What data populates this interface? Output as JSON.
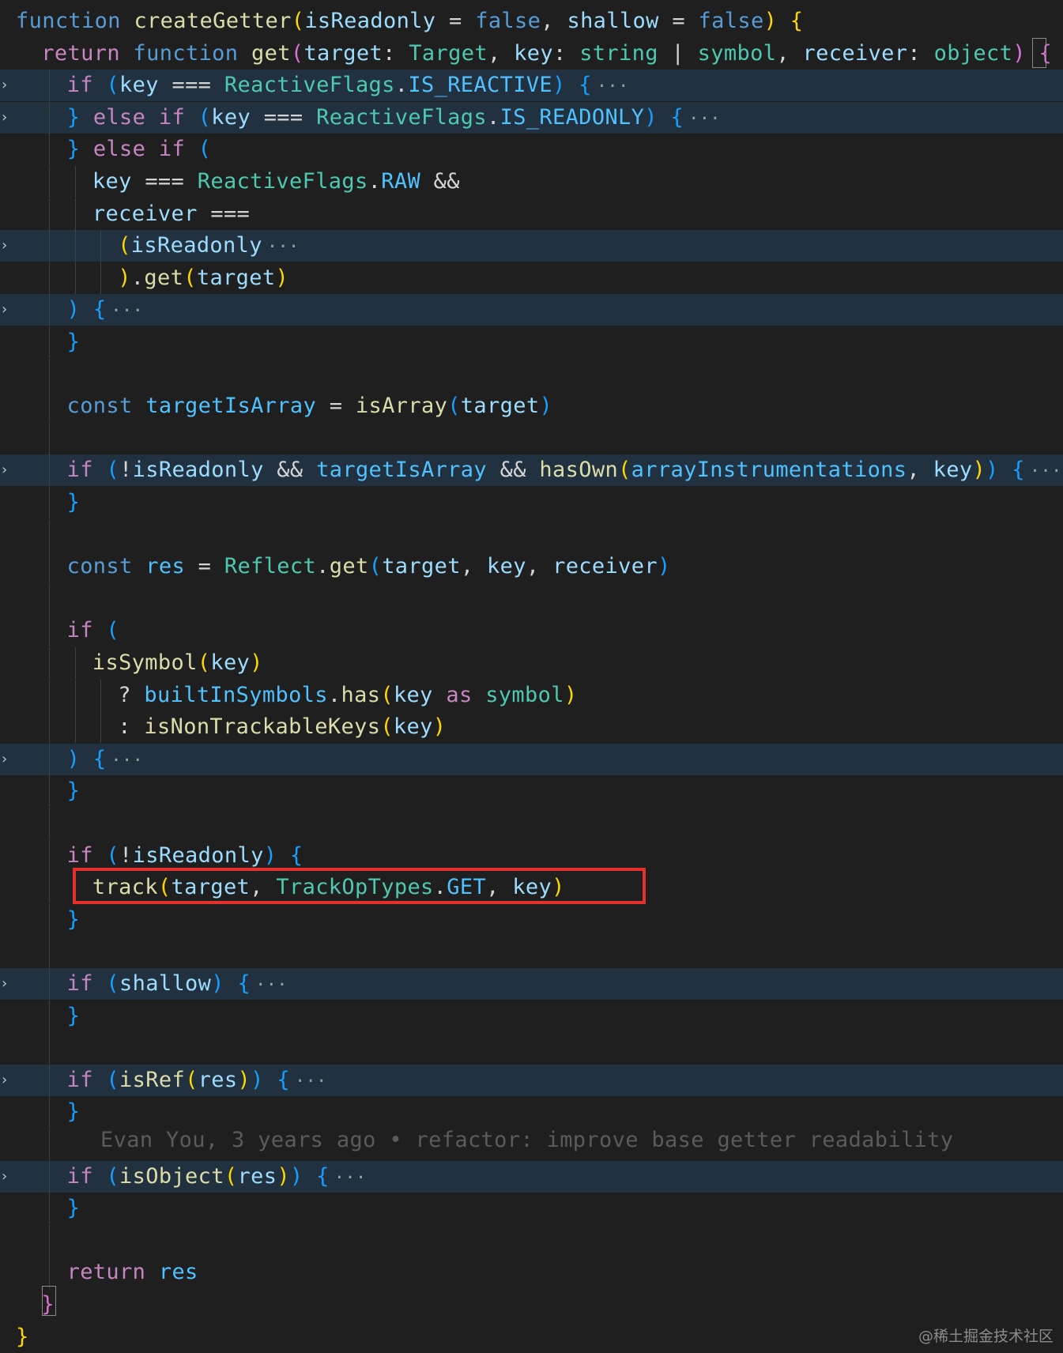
{
  "editor": {
    "lines": [
      {
        "fold": false,
        "hl": false,
        "indent": 0,
        "tokens": [
          [
            "kw",
            "function "
          ],
          [
            "fn",
            "createGetter"
          ],
          [
            "b1",
            "("
          ],
          [
            "var",
            "isReadonly"
          ],
          [
            "op",
            " = "
          ],
          [
            "kw",
            "false"
          ],
          [
            "op",
            ", "
          ],
          [
            "var",
            "shallow"
          ],
          [
            "op",
            " = "
          ],
          [
            "kw",
            "false"
          ],
          [
            "b1",
            ")"
          ],
          [
            "op",
            " "
          ],
          [
            "b1",
            "{"
          ]
        ]
      },
      {
        "fold": false,
        "hl": false,
        "indent": 1,
        "tokens": [
          [
            "ctl",
            "return "
          ],
          [
            "kw",
            "function "
          ],
          [
            "fn",
            "get"
          ],
          [
            "b2",
            "("
          ],
          [
            "var",
            "target"
          ],
          [
            "op",
            ": "
          ],
          [
            "typ",
            "Target"
          ],
          [
            "op",
            ", "
          ],
          [
            "var",
            "key"
          ],
          [
            "op",
            ": "
          ],
          [
            "typ",
            "string"
          ],
          [
            "op",
            " | "
          ],
          [
            "typ",
            "symbol"
          ],
          [
            "op",
            ", "
          ],
          [
            "var",
            "receiver"
          ],
          [
            "op",
            ": "
          ],
          [
            "typ",
            "object"
          ],
          [
            "b2",
            ")"
          ],
          [
            "op",
            " "
          ],
          [
            "b2",
            "{"
          ]
        ]
      },
      {
        "fold": true,
        "hl": true,
        "indent": 2,
        "tokens": [
          [
            "ctl",
            "if "
          ],
          [
            "b3",
            "("
          ],
          [
            "var",
            "key"
          ],
          [
            "op",
            " === "
          ],
          [
            "typ",
            "ReactiveFlags"
          ],
          [
            "op",
            "."
          ],
          [
            "cst",
            "IS_REACTIVE"
          ],
          [
            "b3",
            ")"
          ],
          [
            "op",
            " "
          ],
          [
            "b3",
            "{"
          ]
        ],
        "ellipsis": "···"
      },
      {
        "fold": true,
        "hl": true,
        "indent": 2,
        "tokens": [
          [
            "b3",
            "}"
          ],
          [
            "op",
            " "
          ],
          [
            "ctl",
            "else if "
          ],
          [
            "b3",
            "("
          ],
          [
            "var",
            "key"
          ],
          [
            "op",
            " === "
          ],
          [
            "typ",
            "ReactiveFlags"
          ],
          [
            "op",
            "."
          ],
          [
            "cst",
            "IS_READONLY"
          ],
          [
            "b3",
            ")"
          ],
          [
            "op",
            " "
          ],
          [
            "b3",
            "{"
          ]
        ],
        "ellipsis": "···"
      },
      {
        "fold": false,
        "hl": false,
        "indent": 2,
        "tokens": [
          [
            "b3",
            "}"
          ],
          [
            "op",
            " "
          ],
          [
            "ctl",
            "else if "
          ],
          [
            "b3",
            "("
          ]
        ]
      },
      {
        "fold": false,
        "hl": false,
        "indent": 3,
        "tokens": [
          [
            "var",
            "key"
          ],
          [
            "op",
            " === "
          ],
          [
            "typ",
            "ReactiveFlags"
          ],
          [
            "op",
            "."
          ],
          [
            "cst",
            "RAW"
          ],
          [
            "op",
            " &&"
          ]
        ]
      },
      {
        "fold": false,
        "hl": false,
        "indent": 3,
        "tokens": [
          [
            "var",
            "receiver"
          ],
          [
            "op",
            " ==="
          ]
        ]
      },
      {
        "fold": true,
        "hl": true,
        "indent": 4,
        "tokens": [
          [
            "b1",
            "("
          ],
          [
            "var",
            "isReadonly"
          ]
        ],
        "ellipsis": "···"
      },
      {
        "fold": false,
        "hl": false,
        "indent": 4,
        "tokens": [
          [
            "b1",
            ")"
          ],
          [
            "op",
            "."
          ],
          [
            "fn",
            "get"
          ],
          [
            "b1",
            "("
          ],
          [
            "var",
            "target"
          ],
          [
            "b1",
            ")"
          ]
        ]
      },
      {
        "fold": true,
        "hl": true,
        "indent": 2,
        "tokens": [
          [
            "b3",
            ")"
          ],
          [
            "op",
            " "
          ],
          [
            "b3",
            "{"
          ]
        ],
        "ellipsis": "···"
      },
      {
        "fold": false,
        "hl": false,
        "indent": 2,
        "tokens": [
          [
            "b3",
            "}"
          ]
        ]
      },
      {
        "fold": false,
        "hl": false,
        "indent": 2,
        "tokens": []
      },
      {
        "fold": false,
        "hl": false,
        "indent": 2,
        "tokens": [
          [
            "kw",
            "const "
          ],
          [
            "cst",
            "targetIsArray"
          ],
          [
            "op",
            " = "
          ],
          [
            "fn",
            "isArray"
          ],
          [
            "b3",
            "("
          ],
          [
            "var",
            "target"
          ],
          [
            "b3",
            ")"
          ]
        ]
      },
      {
        "fold": false,
        "hl": false,
        "indent": 2,
        "tokens": []
      },
      {
        "fold": true,
        "hl": true,
        "indent": 2,
        "tokens": [
          [
            "ctl",
            "if "
          ],
          [
            "b3",
            "("
          ],
          [
            "op",
            "!"
          ],
          [
            "var",
            "isReadonly"
          ],
          [
            "op",
            " && "
          ],
          [
            "cst",
            "targetIsArray"
          ],
          [
            "op",
            " && "
          ],
          [
            "fn",
            "hasOwn"
          ],
          [
            "b1",
            "("
          ],
          [
            "cst",
            "arrayInstrumentations"
          ],
          [
            "op",
            ", "
          ],
          [
            "var",
            "key"
          ],
          [
            "b1",
            ")"
          ],
          [
            "b3",
            ")"
          ],
          [
            "op",
            " "
          ],
          [
            "b3",
            "{"
          ]
        ],
        "ellipsis": "···"
      },
      {
        "fold": false,
        "hl": false,
        "indent": 2,
        "tokens": [
          [
            "b3",
            "}"
          ]
        ]
      },
      {
        "fold": false,
        "hl": false,
        "indent": 2,
        "tokens": []
      },
      {
        "fold": false,
        "hl": false,
        "indent": 2,
        "tokens": [
          [
            "kw",
            "const "
          ],
          [
            "cst",
            "res"
          ],
          [
            "op",
            " = "
          ],
          [
            "typ",
            "Reflect"
          ],
          [
            "op",
            "."
          ],
          [
            "fn",
            "get"
          ],
          [
            "b3",
            "("
          ],
          [
            "var",
            "target"
          ],
          [
            "op",
            ", "
          ],
          [
            "var",
            "key"
          ],
          [
            "op",
            ", "
          ],
          [
            "var",
            "receiver"
          ],
          [
            "b3",
            ")"
          ]
        ]
      },
      {
        "fold": false,
        "hl": false,
        "indent": 2,
        "tokens": []
      },
      {
        "fold": false,
        "hl": false,
        "indent": 2,
        "tokens": [
          [
            "ctl",
            "if "
          ],
          [
            "b3",
            "("
          ]
        ]
      },
      {
        "fold": false,
        "hl": false,
        "indent": 3,
        "tokens": [
          [
            "fn",
            "isSymbol"
          ],
          [
            "b1",
            "("
          ],
          [
            "var",
            "key"
          ],
          [
            "b1",
            ")"
          ]
        ]
      },
      {
        "fold": false,
        "hl": false,
        "indent": 4,
        "tokens": [
          [
            "op",
            "? "
          ],
          [
            "cst",
            "builtInSymbols"
          ],
          [
            "op",
            "."
          ],
          [
            "fn",
            "has"
          ],
          [
            "b1",
            "("
          ],
          [
            "var",
            "key"
          ],
          [
            "ctl",
            " as "
          ],
          [
            "typ",
            "symbol"
          ],
          [
            "b1",
            ")"
          ]
        ]
      },
      {
        "fold": false,
        "hl": false,
        "indent": 4,
        "tokens": [
          [
            "op",
            ": "
          ],
          [
            "fn",
            "isNonTrackableKeys"
          ],
          [
            "b1",
            "("
          ],
          [
            "var",
            "key"
          ],
          [
            "b1",
            ")"
          ]
        ]
      },
      {
        "fold": true,
        "hl": true,
        "indent": 2,
        "tokens": [
          [
            "b3",
            ")"
          ],
          [
            "op",
            " "
          ],
          [
            "b3",
            "{"
          ]
        ],
        "ellipsis": "···"
      },
      {
        "fold": false,
        "hl": false,
        "indent": 2,
        "tokens": [
          [
            "b3",
            "}"
          ]
        ]
      },
      {
        "fold": false,
        "hl": false,
        "indent": 2,
        "tokens": []
      },
      {
        "fold": false,
        "hl": false,
        "indent": 2,
        "tokens": [
          [
            "ctl",
            "if "
          ],
          [
            "b3",
            "("
          ],
          [
            "op",
            "!"
          ],
          [
            "var",
            "isReadonly"
          ],
          [
            "b3",
            ")"
          ],
          [
            "op",
            " "
          ],
          [
            "b3",
            "{"
          ]
        ]
      },
      {
        "fold": false,
        "hl": false,
        "indent": 3,
        "tokens": [
          [
            "fn",
            "track"
          ],
          [
            "b1",
            "("
          ],
          [
            "var",
            "target"
          ],
          [
            "op",
            ", "
          ],
          [
            "typ",
            "TrackOpTypes"
          ],
          [
            "op",
            "."
          ],
          [
            "cst",
            "GET"
          ],
          [
            "op",
            ", "
          ],
          [
            "var",
            "key"
          ],
          [
            "b1",
            ")"
          ]
        ]
      },
      {
        "fold": false,
        "hl": false,
        "indent": 2,
        "tokens": [
          [
            "b3",
            "}"
          ]
        ]
      },
      {
        "fold": false,
        "hl": false,
        "indent": 2,
        "tokens": []
      },
      {
        "fold": true,
        "hl": true,
        "indent": 2,
        "tokens": [
          [
            "ctl",
            "if "
          ],
          [
            "b3",
            "("
          ],
          [
            "var",
            "shallow"
          ],
          [
            "b3",
            ")"
          ],
          [
            "op",
            " "
          ],
          [
            "b3",
            "{"
          ]
        ],
        "ellipsis": "···"
      },
      {
        "fold": false,
        "hl": false,
        "indent": 2,
        "tokens": [
          [
            "b3",
            "}"
          ]
        ]
      },
      {
        "fold": false,
        "hl": false,
        "indent": 2,
        "tokens": []
      },
      {
        "fold": true,
        "hl": true,
        "indent": 2,
        "tokens": [
          [
            "ctl",
            "if "
          ],
          [
            "b3",
            "("
          ],
          [
            "fn",
            "isRef"
          ],
          [
            "b1",
            "("
          ],
          [
            "var",
            "res"
          ],
          [
            "b1",
            ")"
          ],
          [
            "b3",
            ")"
          ],
          [
            "op",
            " "
          ],
          [
            "b3",
            "{"
          ]
        ],
        "ellipsis": "···"
      },
      {
        "fold": false,
        "hl": false,
        "indent": 2,
        "tokens": [
          [
            "b3",
            "}"
          ]
        ]
      },
      {
        "fold": false,
        "hl": false,
        "indent": 2,
        "tokens": [],
        "blame_line": true
      },
      {
        "fold": true,
        "hl": true,
        "indent": 2,
        "tokens": [
          [
            "ctl",
            "if "
          ],
          [
            "b3",
            "("
          ],
          [
            "fn",
            "isObject"
          ],
          [
            "b1",
            "("
          ],
          [
            "var",
            "res"
          ],
          [
            "b1",
            ")"
          ],
          [
            "b3",
            ")"
          ],
          [
            "op",
            " "
          ],
          [
            "b3",
            "{"
          ]
        ],
        "ellipsis": "···"
      },
      {
        "fold": false,
        "hl": false,
        "indent": 2,
        "tokens": [
          [
            "b3",
            "}"
          ]
        ]
      },
      {
        "fold": false,
        "hl": false,
        "indent": 2,
        "tokens": []
      },
      {
        "fold": false,
        "hl": false,
        "indent": 2,
        "tokens": [
          [
            "ctl",
            "return "
          ],
          [
            "cst",
            "res"
          ]
        ]
      },
      {
        "fold": false,
        "hl": false,
        "indent": 1,
        "tokens": [
          [
            "b2",
            "}"
          ]
        ]
      },
      {
        "fold": false,
        "hl": false,
        "indent": 0,
        "tokens": [
          [
            "b1",
            "}"
          ]
        ]
      }
    ],
    "blame": "Evan You, 3 years ago • refactor: improve base getter readability"
  },
  "watermark": "@稀土掘金技术社区",
  "icons": {
    "fold": "chevron-right-icon"
  },
  "colors": {
    "background": "#1f1f1f",
    "highlight_border": "#e5302b",
    "folded_line": "#223140"
  }
}
